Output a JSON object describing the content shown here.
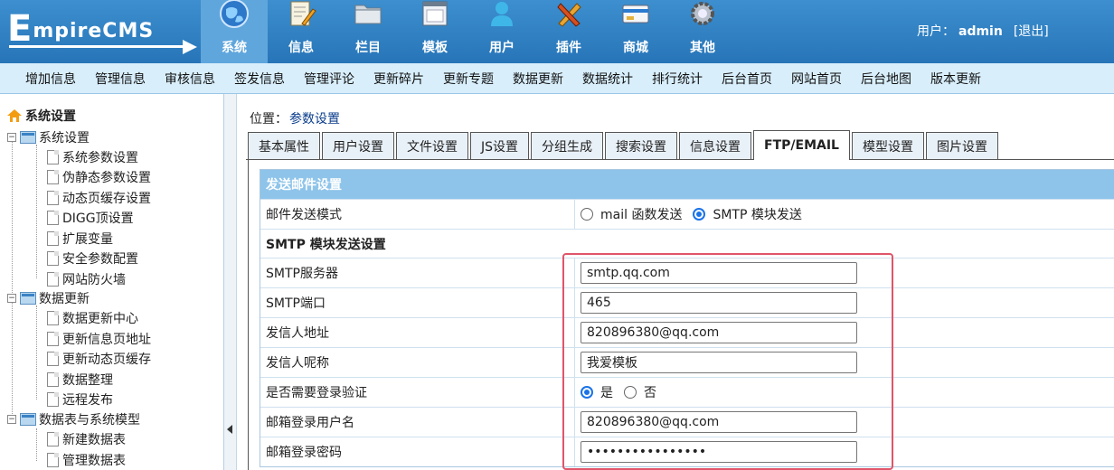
{
  "brand": "EmpireCMS",
  "nav": [
    {
      "label": "系统",
      "icon": "globe-icon"
    },
    {
      "label": "信息",
      "icon": "edit-icon"
    },
    {
      "label": "栏目",
      "icon": "folder-icon"
    },
    {
      "label": "模板",
      "icon": "template-icon"
    },
    {
      "label": "用户",
      "icon": "user-icon"
    },
    {
      "label": "插件",
      "icon": "plugin-icon"
    },
    {
      "label": "商城",
      "icon": "card-icon"
    },
    {
      "label": "其他",
      "icon": "gear-icon"
    }
  ],
  "user": {
    "prefix": "用户：",
    "name": "admin",
    "logout": "[退出]"
  },
  "submenu": [
    "增加信息",
    "管理信息",
    "审核信息",
    "签发信息",
    "管理评论",
    "更新碎片",
    "更新专题",
    "数据更新",
    "数据统计",
    "排行统计",
    "后台首页",
    "网站首页",
    "后台地图",
    "版本更新"
  ],
  "sidebar": {
    "root": "系统设置",
    "groups": [
      {
        "label": "系统设置",
        "items": [
          "系统参数设置",
          "伪静态参数设置",
          "动态页缓存设置",
          "DIGG顶设置",
          "扩展变量",
          "安全参数配置",
          "网站防火墙"
        ]
      },
      {
        "label": "数据更新",
        "items": [
          "数据更新中心",
          "更新信息页地址",
          "更新动态页缓存",
          "数据整理",
          "远程发布"
        ]
      },
      {
        "label": "数据表与系统模型",
        "items": [
          "新建数据表",
          "管理数据表"
        ]
      }
    ]
  },
  "location": {
    "prefix": "位置：",
    "value": "参数设置"
  },
  "tabs": [
    "基本属性",
    "用户设置",
    "文件设置",
    "JS设置",
    "分组生成",
    "搜索设置",
    "信息设置",
    "FTP/EMAIL",
    "模型设置",
    "图片设置"
  ],
  "form": {
    "header": "发送邮件设置",
    "mail_mode_label": "邮件发送模式",
    "mail_mode_opt1": "mail 函数发送",
    "mail_mode_opt2": "SMTP 模块发送",
    "smtp_section": "SMTP 模块发送设置",
    "smtp_server_label": "SMTP服务器",
    "smtp_server": "smtp.qq.com",
    "smtp_port_label": "SMTP端口",
    "smtp_port": "465",
    "sender_label": "发信人地址",
    "sender": "820896380@qq.com",
    "nickname_label": "发信人呢称",
    "nickname": "我爱模板",
    "auth_label": "是否需要登录验证",
    "auth_yes": "是",
    "auth_no": "否",
    "username_label": "邮箱登录用户名",
    "username": "820896380@qq.com",
    "password_label": "邮箱登录密码",
    "password": "••••••••••••••••"
  }
}
